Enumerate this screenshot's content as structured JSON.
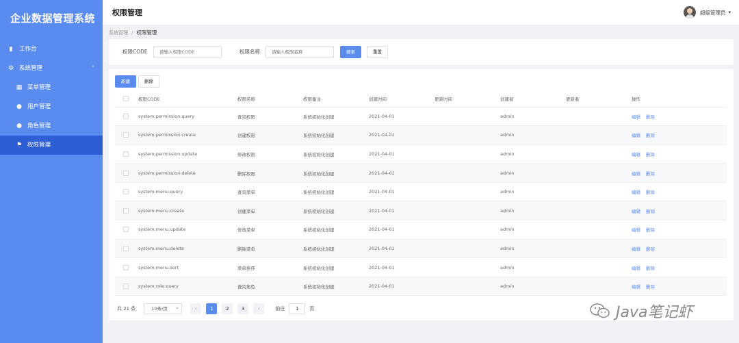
{
  "app": {
    "brand": "企业数据管理系统"
  },
  "sidebar": {
    "items": [
      {
        "label": "工作台",
        "icon": "bar-chart-icon",
        "glyph": "▮",
        "level": "top",
        "active": false
      },
      {
        "label": "系统管理",
        "icon": "gear-icon",
        "glyph": "⚙",
        "level": "top",
        "active": false,
        "expanded": true
      },
      {
        "label": "菜单管理",
        "icon": "grid-icon",
        "glyph": "▦",
        "level": "sub",
        "active": false
      },
      {
        "label": "用户管理",
        "icon": "user-icon",
        "glyph": "●",
        "level": "sub",
        "active": false
      },
      {
        "label": "角色管理",
        "icon": "user-icon",
        "glyph": "●",
        "level": "sub",
        "active": false
      },
      {
        "label": "权限管理",
        "icon": "flag-icon",
        "glyph": "⚑",
        "level": "sub",
        "active": true
      }
    ]
  },
  "header": {
    "title": "权限管理",
    "user_name": "超级管理员"
  },
  "breadcrumb": {
    "parent": "系统管理",
    "separator": "/",
    "current": "权限管理"
  },
  "search": {
    "code_label": "权限CODE",
    "code_placeholder": "请输入权限CODE",
    "name_label": "权限名称",
    "name_placeholder": "请输入权限名称",
    "search_button": "搜索",
    "reset_button": "重置"
  },
  "toolbar": {
    "new_button": "新建",
    "delete_button": "删除"
  },
  "table": {
    "columns": [
      "权限CODE",
      "权限名称",
      "权限备注",
      "创建时间",
      "更新时间",
      "创建者",
      "更新者",
      "操作"
    ],
    "action_edit": "编辑",
    "action_delete": "删除",
    "rows": [
      {
        "code": "system:permission:query",
        "name": "查询权限",
        "remark": "系统初始化创建",
        "created": "2021-04-01",
        "updated": "",
        "creator": "admin",
        "updater": ""
      },
      {
        "code": "system:permission:create",
        "name": "创建权限",
        "remark": "系统初始化创建",
        "created": "2021-04-01",
        "updated": "",
        "creator": "admin",
        "updater": ""
      },
      {
        "code": "system:permission:update",
        "name": "修改权限",
        "remark": "系统初始化创建",
        "created": "2021-04-01",
        "updated": "",
        "creator": "admin",
        "updater": ""
      },
      {
        "code": "system:permission:delete",
        "name": "删除权限",
        "remark": "系统初始化创建",
        "created": "2021-04-01",
        "updated": "",
        "creator": "admin",
        "updater": ""
      },
      {
        "code": "system:menu:query",
        "name": "查询菜单",
        "remark": "系统初始化创建",
        "created": "2021-04-01",
        "updated": "",
        "creator": "admin",
        "updater": ""
      },
      {
        "code": "system:menu:create",
        "name": "创建菜单",
        "remark": "系统初始化创建",
        "created": "2021-04-01",
        "updated": "",
        "creator": "admin",
        "updater": ""
      },
      {
        "code": "system:menu:update",
        "name": "修改菜单",
        "remark": "系统初始化创建",
        "created": "2021-04-01",
        "updated": "",
        "creator": "admin",
        "updater": ""
      },
      {
        "code": "system:menu:delete",
        "name": "删除菜单",
        "remark": "系统初始化创建",
        "created": "2021-04-01",
        "updated": "",
        "creator": "admin",
        "updater": ""
      },
      {
        "code": "system:menu:sort",
        "name": "菜单排序",
        "remark": "系统初始化创建",
        "created": "2021-04-01",
        "updated": "",
        "creator": "admin",
        "updater": ""
      },
      {
        "code": "system:role:query",
        "name": "查询角色",
        "remark": "系统初始化创建",
        "created": "2021-04-01",
        "updated": "",
        "creator": "admin",
        "updater": ""
      }
    ]
  },
  "pagination": {
    "total_text": "共 21 条",
    "page_size": "10条/页",
    "pages": [
      "1",
      "2",
      "3"
    ],
    "current_page": "1",
    "goto_label": "前往",
    "goto_value": "1",
    "goto_suffix": "页"
  },
  "watermark": {
    "text": "Java笔记虾"
  },
  "colors": {
    "accent": "#5a8cf0",
    "sidebar_active": "#2e5ed4"
  }
}
